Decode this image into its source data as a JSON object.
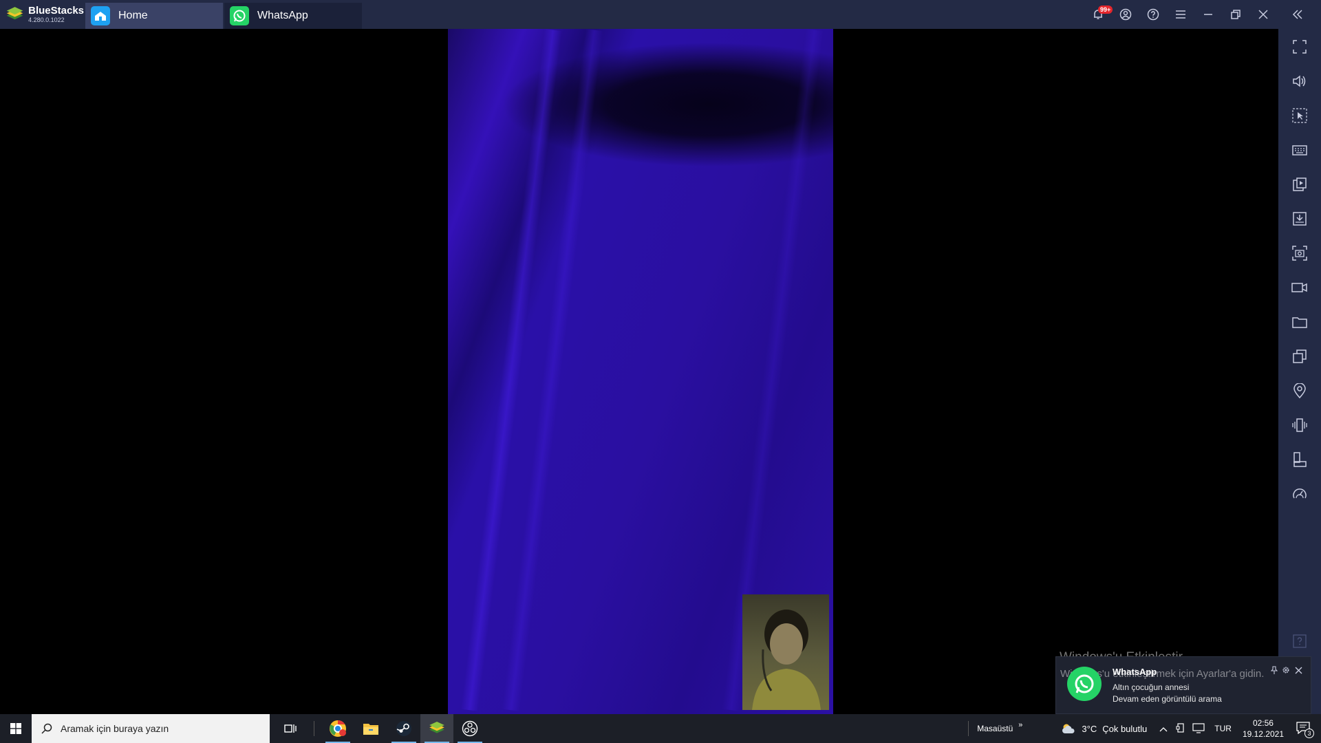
{
  "window": {
    "app_name": "BlueStacks",
    "version": "4.280.0.1022",
    "notification_count": "99+"
  },
  "tabs": [
    {
      "label": "Home",
      "icon": "home-icon"
    },
    {
      "label": "WhatsApp",
      "icon": "whatsapp-icon"
    }
  ],
  "sidebar_tools": [
    "fullscreen-icon",
    "volume-icon",
    "pointer-icon",
    "keyboard-icon",
    "macro-icon",
    "install-apk-icon",
    "screenshot-icon",
    "record-icon",
    "folder-icon",
    "multi-instance-icon",
    "location-icon",
    "shake-icon",
    "rotate-icon",
    "speed-icon",
    "help-icon"
  ],
  "taskbar": {
    "search_placeholder": "Aramak için buraya yazın",
    "desktop_label": "Masaüstü",
    "temperature": "3°C",
    "weather": "Çok bulutlu",
    "language": "TUR",
    "time": "02:56",
    "date": "19.12.2021",
    "action_center_count": "3",
    "apps": [
      "task-view-icon",
      "chrome-icon",
      "file-explorer-icon",
      "steam-icon",
      "bluestacks-icon",
      "obs-icon"
    ]
  },
  "activation": {
    "title": "Windows'u Etkinleştir",
    "subtitle": "Windows'u etkinleştirmek için Ayarlar'a gidin."
  },
  "notification": {
    "app": "WhatsApp",
    "contact": "Altın çocuğun annesi",
    "message": "Devam eden görüntülü arama"
  },
  "colors": {
    "titlebar": "#232a45",
    "video_accent": "#2a10a8",
    "whatsapp_green": "#25d366",
    "taskbar": "#1c1f27"
  }
}
